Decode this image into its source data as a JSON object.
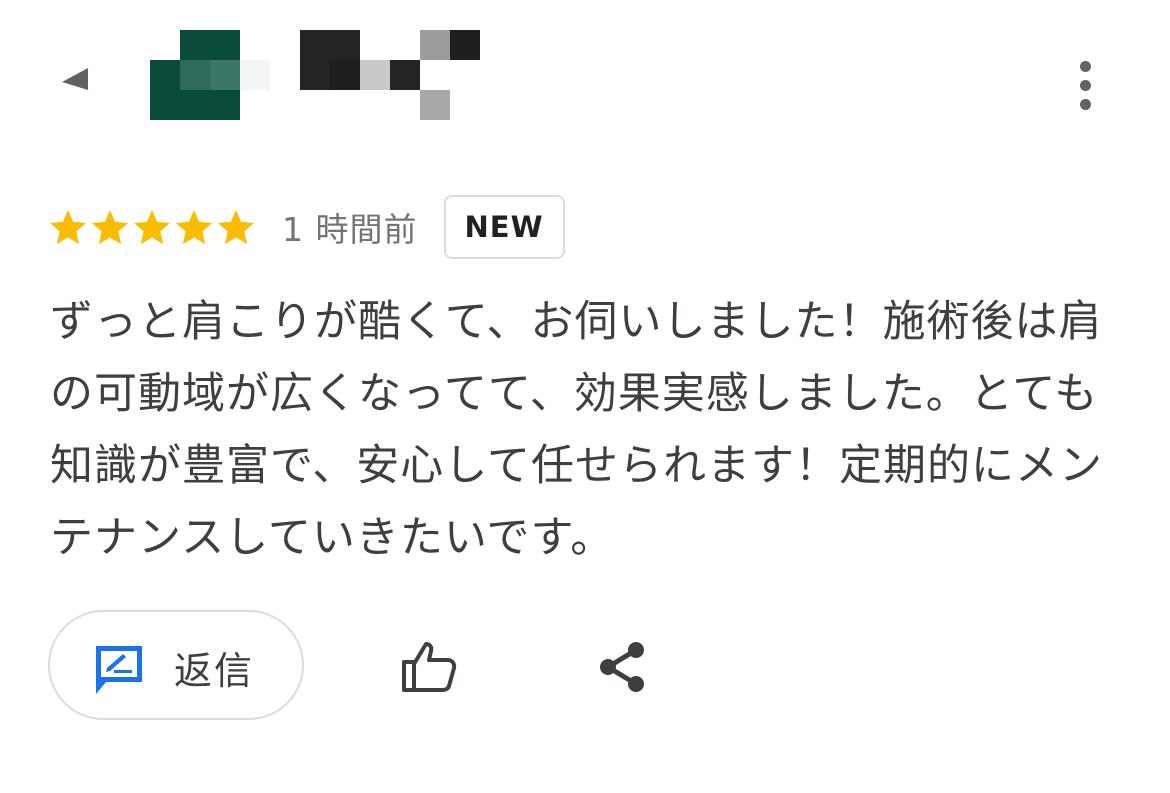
{
  "header": {
    "back_icon": "back-arrow-icon",
    "more_icon": "more-vert-icon"
  },
  "review": {
    "rating": 5,
    "max_rating": 5,
    "star_color": "#fbbc04",
    "time": "1 時間前",
    "badge": "NEW",
    "text": "ずっと肩こりが酷くて、お伺いしました！施術後は肩の可動域が広くなってて、効果実感しました。とても知識が豊富で、安心して任せられます！定期的にメンテナンスしていきたいです。"
  },
  "actions": {
    "reply_label": "返信",
    "reply_icon": "reply-comment-icon",
    "reply_icon_color": "#1a73e8",
    "like_icon": "thumb-up-icon",
    "share_icon": "share-icon"
  }
}
